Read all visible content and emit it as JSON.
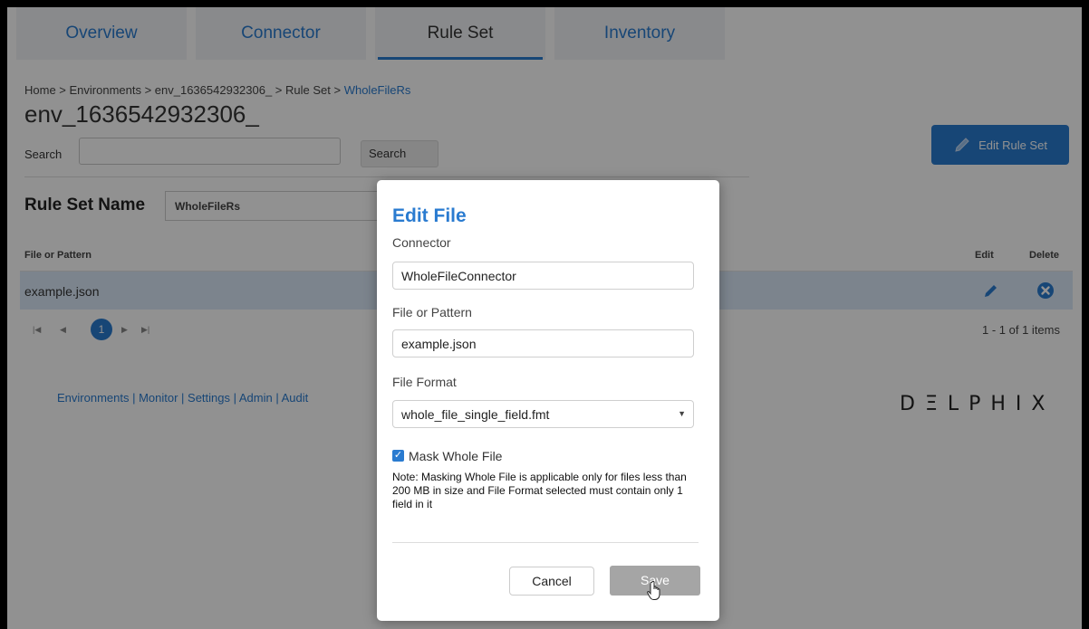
{
  "tabs": [
    {
      "label": "Overview"
    },
    {
      "label": "Connector"
    },
    {
      "label": "Rule Set"
    },
    {
      "label": "Inventory"
    }
  ],
  "breadcrumb": {
    "path": "Home > Environments > env_1636542932306_ > Rule Set > ",
    "current": "WholeFileRs"
  },
  "page_title": "env_1636542932306_",
  "search": {
    "label": "Search",
    "value": "",
    "button": "Search"
  },
  "edit_ruleset_button": "Edit Rule Set",
  "rule_set": {
    "label": "Rule Set Name",
    "value": "WholeFileRs"
  },
  "grid": {
    "headers": {
      "file": "File or Pattern",
      "edit": "Edit",
      "delete": "Delete"
    },
    "rows": [
      {
        "file": "example.json"
      }
    ]
  },
  "pager": {
    "page": "1",
    "count_text": "1 - 1 of 1 items"
  },
  "footer_links": "Environments | Monitor | Settings | Admin | Audit",
  "brand": "DΞLPHIX",
  "modal": {
    "title": "Edit File",
    "connector_label": "Connector",
    "connector_value": "WholeFileConnector",
    "pattern_label": "File or Pattern",
    "pattern_value": "example.json",
    "format_label": "File Format",
    "format_value": "whole_file_single_field.fmt",
    "mask_label": "Mask Whole File",
    "mask_checked": true,
    "note": "Note: Masking Whole File is applicable only for files less than 200 MB in size and File Format selected must contain only 1 field in it",
    "cancel": "Cancel",
    "save": "Save"
  },
  "colors": {
    "accent": "#2a7bd0",
    "row_selected": "#dbe8f8",
    "save_disabled": "#a5a5a5"
  }
}
